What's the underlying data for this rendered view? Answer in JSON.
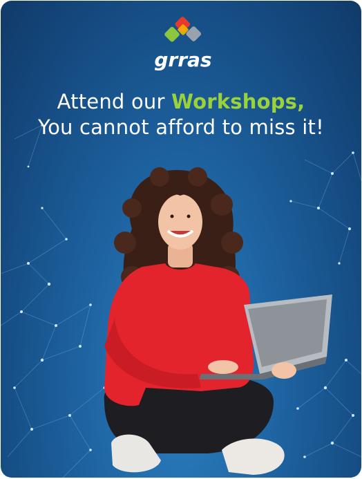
{
  "brand": {
    "name": "grras",
    "logo_colors": [
      "#e63a2e",
      "#f4b400",
      "#8cc63f",
      "#9aa3ad"
    ]
  },
  "headline": {
    "line1_prefix": "Attend our ",
    "line1_accent": "Workshops,",
    "line2": "You cannot afford to miss it!"
  },
  "colors": {
    "background": "#1c5f9c",
    "accent": "#9bd13b",
    "text": "#ffffff",
    "sweater": "#e4242c"
  }
}
